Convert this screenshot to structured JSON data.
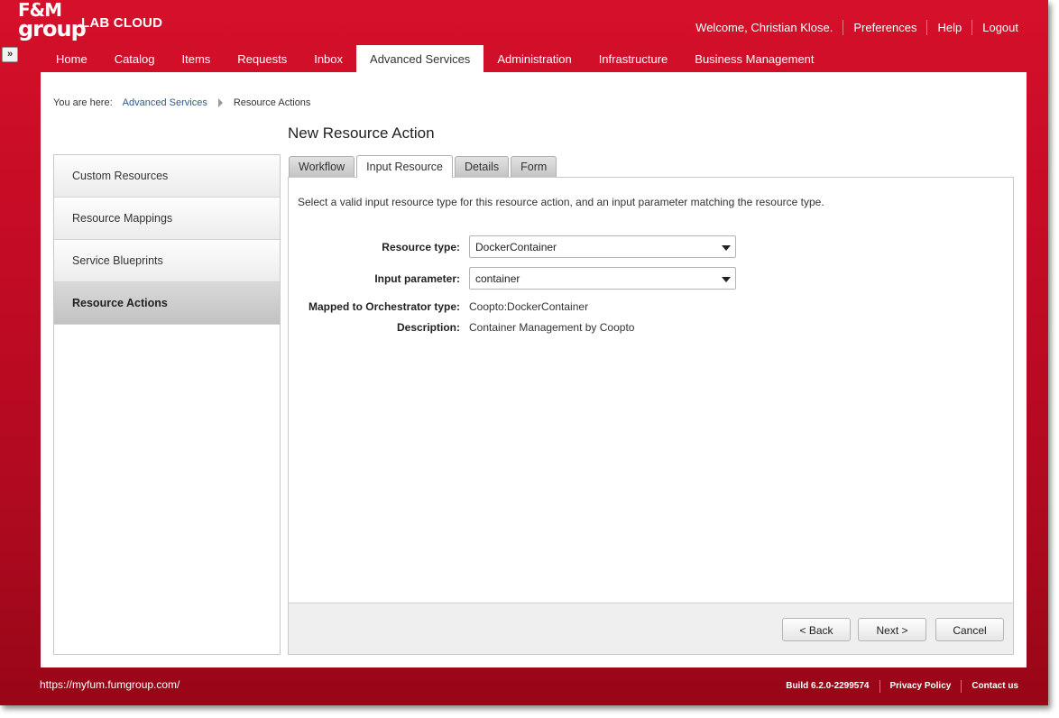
{
  "header": {
    "logo_line1": "F&M",
    "logo_line2": "group",
    "brand": "LAB CLOUD",
    "expander_glyph": "»",
    "welcome": "Welcome, Christian Klose.",
    "preferences": "Preferences",
    "help": "Help",
    "logout": "Logout"
  },
  "nav": {
    "tabs": [
      "Home",
      "Catalog",
      "Items",
      "Requests",
      "Inbox",
      "Advanced Services",
      "Administration",
      "Infrastructure",
      "Business Management"
    ],
    "active": "Advanced Services"
  },
  "breadcrumb": {
    "prefix": "You are here:",
    "link": "Advanced Services",
    "current": "Resource Actions"
  },
  "page": {
    "title": "New Resource Action"
  },
  "sidebar": {
    "items": [
      "Custom Resources",
      "Resource Mappings",
      "Service Blueprints",
      "Resource Actions"
    ],
    "active": "Resource Actions"
  },
  "tabs": {
    "items": [
      "Workflow",
      "Input Resource",
      "Details",
      "Form"
    ],
    "active": "Input Resource"
  },
  "form": {
    "intro": "Select a valid input resource type for this resource action, and an input parameter matching the resource type.",
    "resource_type_label": "Resource type:",
    "resource_type_value": "DockerContainer",
    "input_parameter_label": "Input parameter:",
    "input_parameter_value": "container",
    "mapped_label": "Mapped to Orchestrator type:",
    "mapped_value": "Coopto:DockerContainer",
    "description_label": "Description:",
    "description_value": "Container Management by Coopto"
  },
  "buttons": {
    "back": "< Back",
    "next": "Next >",
    "cancel": "Cancel"
  },
  "footer": {
    "url": "https://myfum.fumgroup.com/",
    "build": "Build 6.2.0-2299574",
    "privacy": "Privacy Policy",
    "contact": "Contact us"
  },
  "colors": {
    "brand_red": "#c40b25",
    "link_blue": "#2e5a8a"
  }
}
